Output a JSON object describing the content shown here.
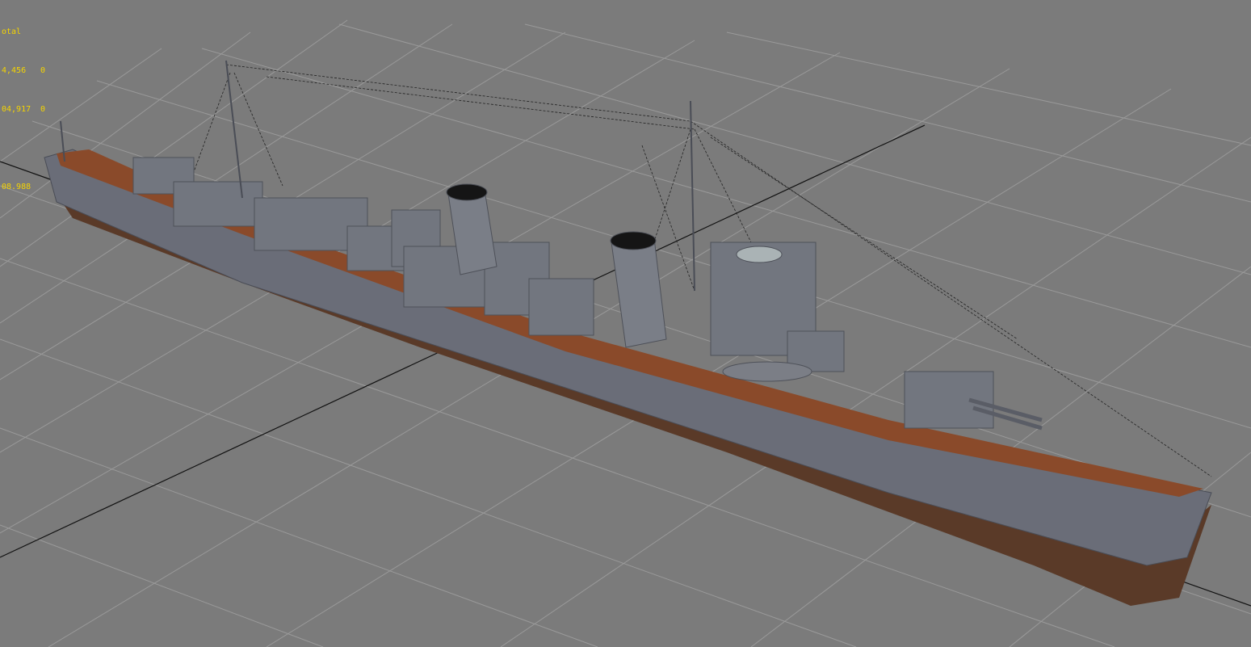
{
  "viewport": {
    "background_color": "#7b7b7b",
    "grid_color": "#9a9a9a",
    "axis_color": "#111111",
    "stats_color": "#f5d400"
  },
  "stats": {
    "header": "otal",
    "polys_label": "4,456",
    "polys_value": "0",
    "verts_label": "04,917",
    "verts_value": "0",
    "fps_value": "08.988"
  },
  "model": {
    "hull_color": "#6a6d78",
    "deck_color": "#8a4a2a",
    "lower_hull_color": "#5a3a28"
  }
}
